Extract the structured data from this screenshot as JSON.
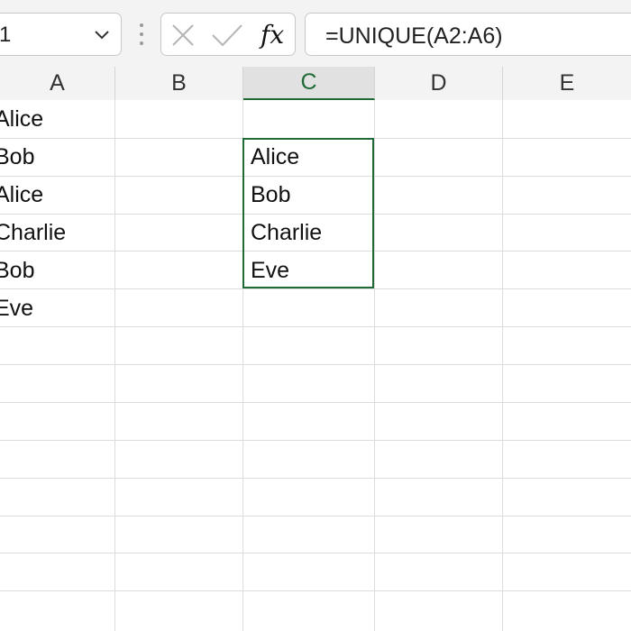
{
  "name_box": {
    "value": "1"
  },
  "formula_bar": {
    "formula": "=UNIQUE(A2:A6)",
    "fx_label": "fx"
  },
  "columns": [
    "A",
    "B",
    "C",
    "D",
    "E"
  ],
  "active_column": "C",
  "cells": {
    "A1": "Alice",
    "A2": "Bob",
    "A3": "Alice",
    "A4": "Charlie",
    "A5": "Bob",
    "A6": "Eve",
    "C2": "Alice",
    "C3": "Bob",
    "C4": "Charlie",
    "C5": "Eve"
  },
  "colors": {
    "accent": "#1e6b37",
    "gridline": "#dcdcdc",
    "header_bg": "#f3f3f3"
  }
}
